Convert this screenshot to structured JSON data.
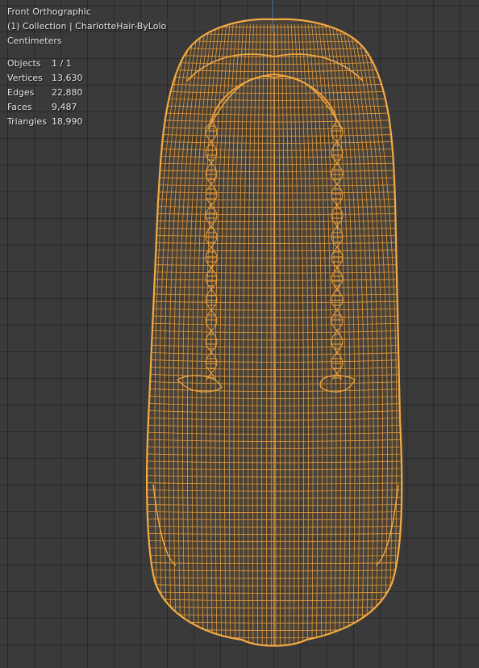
{
  "viewport": {
    "view_name": "Front Orthographic",
    "collection_line": "(1) Collection | CharlotteHair-ByLolo",
    "units": "Centimeters"
  },
  "stats": [
    {
      "label": "Objects",
      "value": "1 / 1"
    },
    {
      "label": "Vertices",
      "value": "13,630"
    },
    {
      "label": "Edges",
      "value": "22,880"
    },
    {
      "label": "Faces",
      "value": "9,487"
    },
    {
      "label": "Triangles",
      "value": "18,990"
    }
  ],
  "colors": {
    "background": "#3a3a3a",
    "wireframe": "#f0a038",
    "y_axis": "#4a78c8"
  },
  "mesh": {
    "object": "CharlotteHair-ByLolo",
    "display": "wireframe",
    "selected": true
  }
}
